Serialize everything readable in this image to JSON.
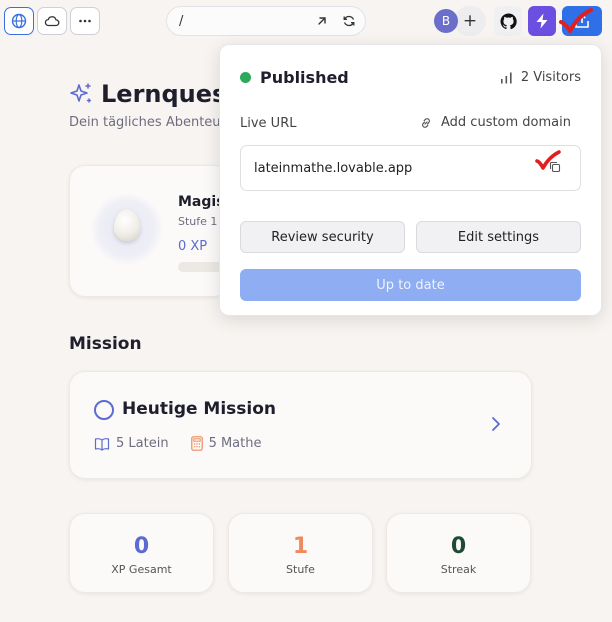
{
  "toolbar": {
    "url_path": "/",
    "avatar_initial": "B"
  },
  "hero": {
    "title": "Lernquest",
    "subtitle": "Dein tägliches Abenteuer"
  },
  "creature": {
    "name": "Magis",
    "level": "Stufe 1",
    "xp": "0 XP",
    "progress": 0
  },
  "mission_section": {
    "title": "Mission"
  },
  "mission": {
    "title": "Heutige Mission",
    "latein": "5 Latein",
    "mathe": "5 Mathe"
  },
  "stats": [
    {
      "value": "0",
      "label": "XP Gesamt",
      "color": "#5b6bd1"
    },
    {
      "value": "1",
      "label": "Stufe",
      "color": "#ef8a5e"
    },
    {
      "value": "0",
      "label": "Streak",
      "color": "#1f4a36"
    }
  ],
  "publish_popover": {
    "status": "Published",
    "visitors": "2 Visitors",
    "live_url_label": "Live URL",
    "custom_domain": "Add custom domain",
    "url": "lateinmathe.lovable.app",
    "review_security": "Review security",
    "edit_settings": "Edit settings",
    "up_to_date": "Up to date"
  },
  "colors": {
    "accent": "#2f6fe8",
    "status_green": "#2bab5a",
    "checkmark_red": "#e02020"
  }
}
